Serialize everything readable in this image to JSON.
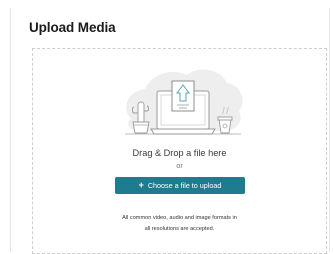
{
  "header": {
    "title": "Upload Media"
  },
  "dropzone": {
    "drag_text": "Drag & Drop a file here",
    "or_text": "or",
    "button_label": "Choose a file to upload",
    "button_icon": "plus-icon",
    "note_line1": "All common video, audio and image formats in",
    "note_line2": "all resolutions are accepted."
  },
  "colors": {
    "accent": "#1f7c8f",
    "text_dark": "#1b1b1b",
    "border": "#cfcfcf"
  },
  "illustration": {
    "icons": [
      "cactus-plant-icon",
      "laptop-icon",
      "upload-document-icon",
      "coffee-cup-icon"
    ]
  }
}
